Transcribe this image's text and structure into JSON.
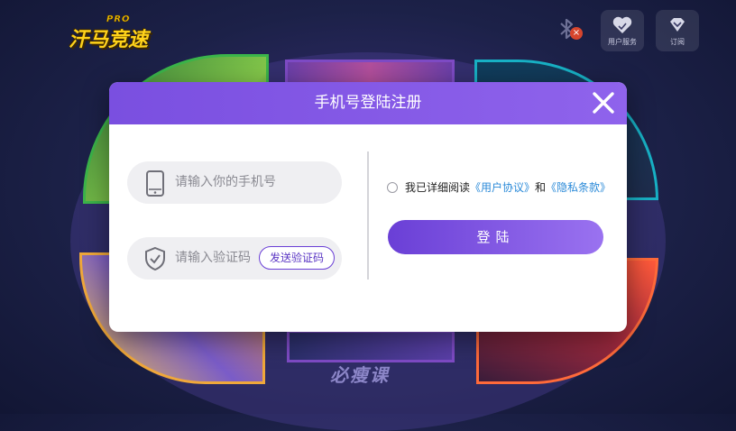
{
  "app": {
    "logo_badge": "PRO",
    "logo_name": "汗马竞速",
    "bluetooth_badge": "×"
  },
  "topbar": {
    "user_service_label": "用户服务",
    "subscribe_label": "订阅"
  },
  "background": {
    "course_label": "必瘦课"
  },
  "dialog": {
    "title": "手机号登陆注册",
    "phone_placeholder": "请输入你的手机号",
    "code_placeholder": "请输入验证码",
    "send_code_label": "发送验证码",
    "agree_prefix": "我已详细阅读",
    "user_agreement": "《用户协议》",
    "and_text": "和",
    "privacy_policy": "《隐私条款》",
    "login_label": "登陆"
  },
  "colors": {
    "accent": "#7a4fe0",
    "link": "#2b8ad8"
  }
}
